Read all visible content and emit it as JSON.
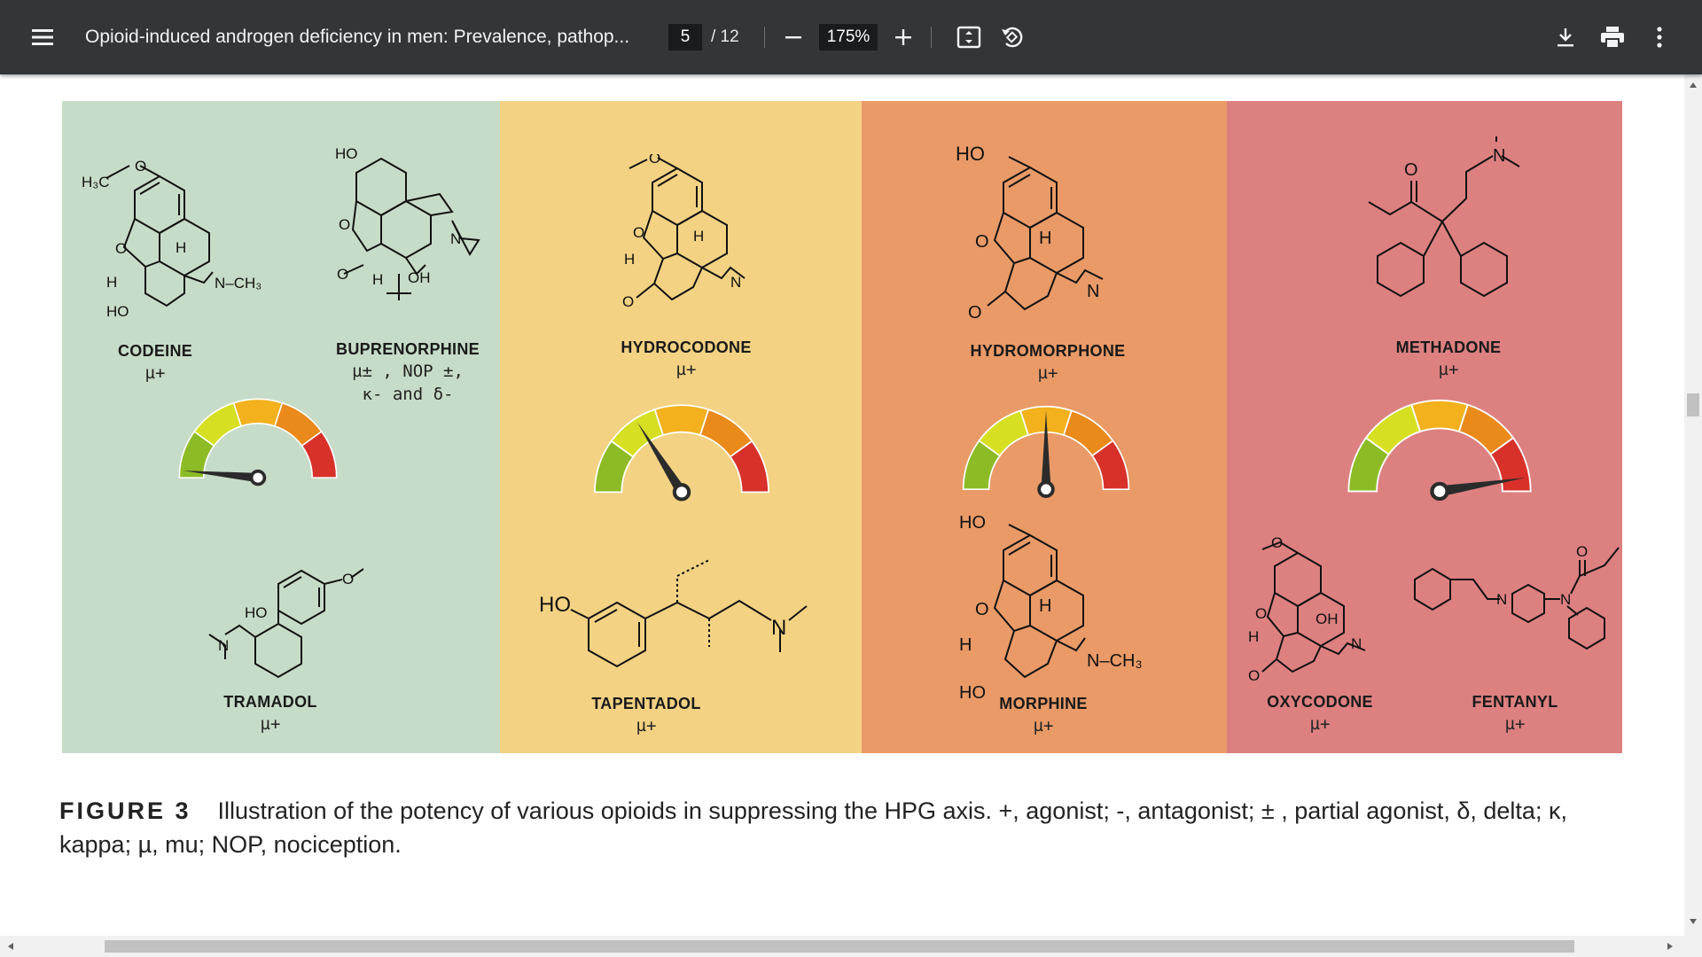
{
  "toolbar": {
    "title": "Opioid-induced androgen deficiency in men: Prevalence, pathop...",
    "page_current": "5",
    "page_total": "/ 12",
    "zoom": "175%"
  },
  "icons": [
    "menu-icon",
    "zoom-out-icon",
    "zoom-in-icon",
    "fit-page-icon",
    "rotate-icon",
    "download-icon",
    "print-icon",
    "more-vert-icon"
  ],
  "colors": {
    "toolbar_bg": "#323639",
    "panel_green": "#c7dcc8",
    "panel_yellow": "#f3d283",
    "panel_orange": "#e99a67",
    "panel_red": "#dd8080"
  },
  "figure": {
    "panels": [
      {
        "color": "#c7dcc8",
        "molecules": [
          {
            "name": "CODEINE",
            "activity": "µ+"
          },
          {
            "name": "BUPRENORPHINE",
            "activity": "µ± , NOP ±,",
            "activity2": "κ-  and  δ-"
          },
          {
            "name": "TRAMADOL",
            "activity": "µ+"
          }
        ],
        "gauge_level": 0.03
      },
      {
        "color": "#f3d283",
        "molecules": [
          {
            "name": "HYDROCODONE",
            "activity": "µ+"
          },
          {
            "name": "TAPENTADOL",
            "activity": "µ+"
          }
        ],
        "gauge_level": 0.32
      },
      {
        "color": "#e99a67",
        "molecules": [
          {
            "name": "HYDROMORPHONE",
            "activity": "µ+"
          },
          {
            "name": "MORPHINE",
            "activity": "µ+"
          }
        ],
        "gauge_level": 0.5
      },
      {
        "color": "#dd8080",
        "molecules": [
          {
            "name": "METHADONE",
            "activity": "µ+"
          },
          {
            "name": "OXYCODONE",
            "activity": "µ+"
          },
          {
            "name": "FENTANYL",
            "activity": "µ+"
          }
        ],
        "gauge_level": 0.95
      }
    ],
    "atoms": {
      "ho": "HO",
      "h3c": "H₃C",
      "o": "O",
      "h": "H",
      "n": "N",
      "nch3": "N–CH₃",
      "oh": "OH"
    }
  },
  "caption": {
    "label": "FIGURE 3",
    "text": "Illustration of the potency of various opioids in suppressing the HPG axis. +, agonist; -, antagonist; ± , partial agonist, δ, delta; κ, kappa; µ, mu; NOP, nociception."
  }
}
